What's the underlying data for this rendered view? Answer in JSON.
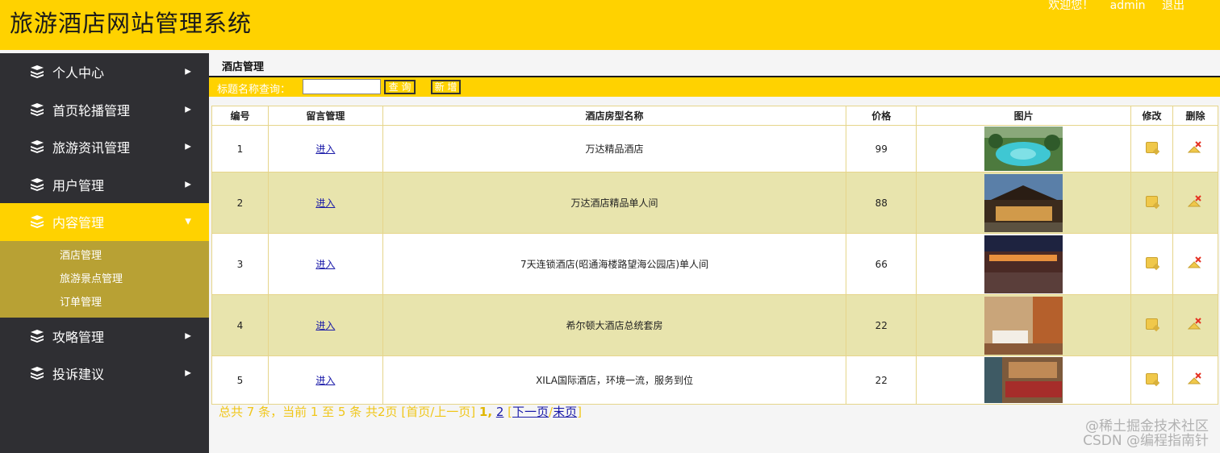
{
  "header": {
    "app_title": "旅游酒店网站管理系统",
    "welcome": "欢迎您！",
    "username": "admin",
    "logout": "退出"
  },
  "sidebar": {
    "items": [
      {
        "label": "个人中心",
        "icon": "stack-icon"
      },
      {
        "label": "首页轮播管理",
        "icon": "stack-icon"
      },
      {
        "label": "旅游资讯管理",
        "icon": "stack-icon"
      },
      {
        "label": "用户管理",
        "icon": "stack-icon"
      },
      {
        "label": "内容管理",
        "icon": "stack-icon",
        "active": true
      },
      {
        "label": "攻略管理",
        "icon": "stack-icon"
      },
      {
        "label": "投诉建议",
        "icon": "stack-icon"
      }
    ],
    "submenu": [
      "酒店管理",
      "旅游景点管理",
      "订单管理"
    ]
  },
  "main": {
    "page_title": "酒店管理",
    "search_label": "标题名称查询：",
    "search_value": "",
    "search_button": "查 询",
    "add_button": "新 增"
  },
  "table": {
    "headers": [
      "编号",
      "留言管理",
      "酒店房型名称",
      "价格",
      "图片",
      "修改",
      "删除"
    ],
    "rows": [
      {
        "id": "1",
        "link": "进入",
        "name": "万达精品酒店",
        "price": "99",
        "image": "pool-photo"
      },
      {
        "id": "2",
        "link": "进入",
        "name": "万达酒店精品单人间",
        "price": "88",
        "image": "building-photo"
      },
      {
        "id": "3",
        "link": "进入",
        "name": "7天连锁酒店(昭通海楼路望海公园店)单人间",
        "price": "66",
        "image": "night-building-photo"
      },
      {
        "id": "4",
        "link": "进入",
        "name": "希尔顿大酒店总统套房",
        "price": "22",
        "image": "room-photo"
      },
      {
        "id": "5",
        "link": "进入",
        "name": "XILA国际酒店，环境一流，服务到位",
        "price": "22",
        "image": "restaurant-photo"
      }
    ]
  },
  "pager": {
    "summary": "总共 7 条，当前 1 至 5 条 共2页",
    "first_prev": "[首页/上一页]",
    "page1": "1,",
    "page2": "2",
    "bracket_open": "[",
    "next": "下一页",
    "slash": "/",
    "last": "末页",
    "bracket_close": "]"
  },
  "watermark": {
    "line1": "@稀土掘金技术社区",
    "line2": "CSDN @编程指南针"
  },
  "colors": {
    "accent": "#ffd200",
    "sidebar_bg": "#2f2f33",
    "submenu_bg": "#b8a134",
    "row_alt": "#e8e4ad"
  }
}
